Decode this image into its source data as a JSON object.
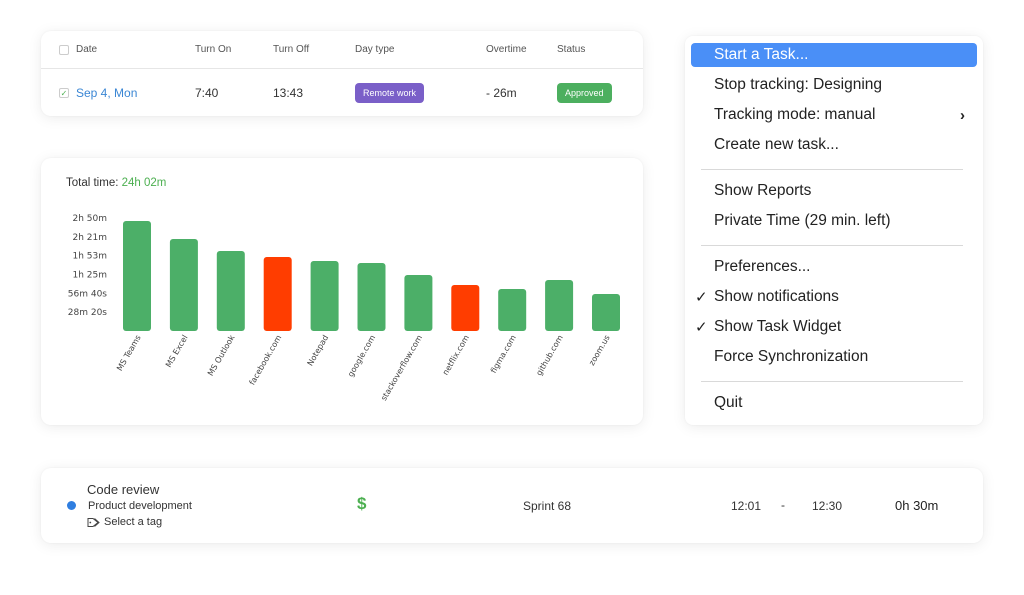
{
  "attendance_table": {
    "headers": {
      "date": "Date",
      "turn_on": "Turn On",
      "turn_off": "Turn Off",
      "day_type": "Day type",
      "overtime": "Overtime",
      "status": "Status"
    },
    "rows": [
      {
        "checked": true,
        "check_glyph": "✓",
        "date": "Sep 4, Mon",
        "turn_on": "7:40",
        "turn_off": "13:43",
        "day_type": "Remote work",
        "overtime": "- 26m",
        "status": "Approved"
      }
    ],
    "colors": {
      "day_type_badge": "#7a5fc8",
      "status_badge": "#4caf5f",
      "date_link": "#3a86d4"
    }
  },
  "chart_data": {
    "type": "bar",
    "title_label": "Total time:",
    "title_value": "24h 02m",
    "xlabel": "",
    "ylabel": "",
    "categories": [
      "MS Teams",
      "MS Excel",
      "MS Outlook",
      "facebook.com",
      "Notepad",
      "google.com",
      "stackoverflow.com",
      "netflix.com",
      "figma.com",
      "github.com",
      "zoom.us"
    ],
    "values_seconds": [
      9930,
      8300,
      7220,
      6680,
      6320,
      6140,
      5060,
      4150,
      3790,
      4600,
      3340
    ],
    "categories_flagged": [
      false,
      false,
      false,
      true,
      false,
      false,
      false,
      true,
      false,
      false,
      false
    ],
    "y_ticks_seconds": [
      1700,
      3400,
      5100,
      6800,
      8500,
      10200
    ],
    "y_tick_labels": [
      "28m 20s",
      "56m 40s",
      "1h 25m",
      "1h 53m",
      "2h 21m",
      "2h 50m"
    ],
    "ylim_seconds": [
      0,
      10200
    ],
    "grid": false,
    "legend": "none",
    "colors": {
      "productive": "#4caf68",
      "unproductive": "#ff3d00",
      "accent": "#4caf50"
    }
  },
  "context_menu": {
    "items": [
      {
        "label": "Start a Task...",
        "highlighted": true,
        "checked": false,
        "submenu": false
      },
      {
        "label": "Stop tracking: Designing",
        "highlighted": false,
        "checked": false,
        "submenu": false
      },
      {
        "label": "Tracking mode: manual",
        "highlighted": false,
        "checked": false,
        "submenu": true
      },
      {
        "label": "Create new task...",
        "highlighted": false,
        "checked": false,
        "submenu": false
      },
      {
        "separator": true
      },
      {
        "label": "Show Reports",
        "highlighted": false,
        "checked": false,
        "submenu": false
      },
      {
        "label": "Private Time (29 min. left)",
        "highlighted": false,
        "checked": false,
        "submenu": false
      },
      {
        "separator": true
      },
      {
        "label": "Preferences...",
        "highlighted": false,
        "checked": false,
        "submenu": false
      },
      {
        "label": "Show notifications",
        "highlighted": false,
        "checked": true,
        "submenu": false
      },
      {
        "label": "Show Task Widget",
        "highlighted": false,
        "checked": true,
        "submenu": false
      },
      {
        "label": "Force Synchronization",
        "highlighted": false,
        "checked": false,
        "submenu": false
      },
      {
        "separator": true
      },
      {
        "label": "Quit",
        "highlighted": false,
        "checked": false,
        "submenu": false
      }
    ],
    "check_glyph": "✓",
    "submenu_glyph": "›",
    "highlight_color": "#4a8ff7"
  },
  "task_entry": {
    "title": "Code review",
    "project": "Product development",
    "project_color": "#2f7ee0",
    "tag_placeholder": "Select a tag",
    "billable_symbol": "$",
    "sprint": "Sprint 68",
    "start_time": "12:01",
    "separator": "-",
    "end_time": "12:30",
    "duration": "0h 30m"
  }
}
